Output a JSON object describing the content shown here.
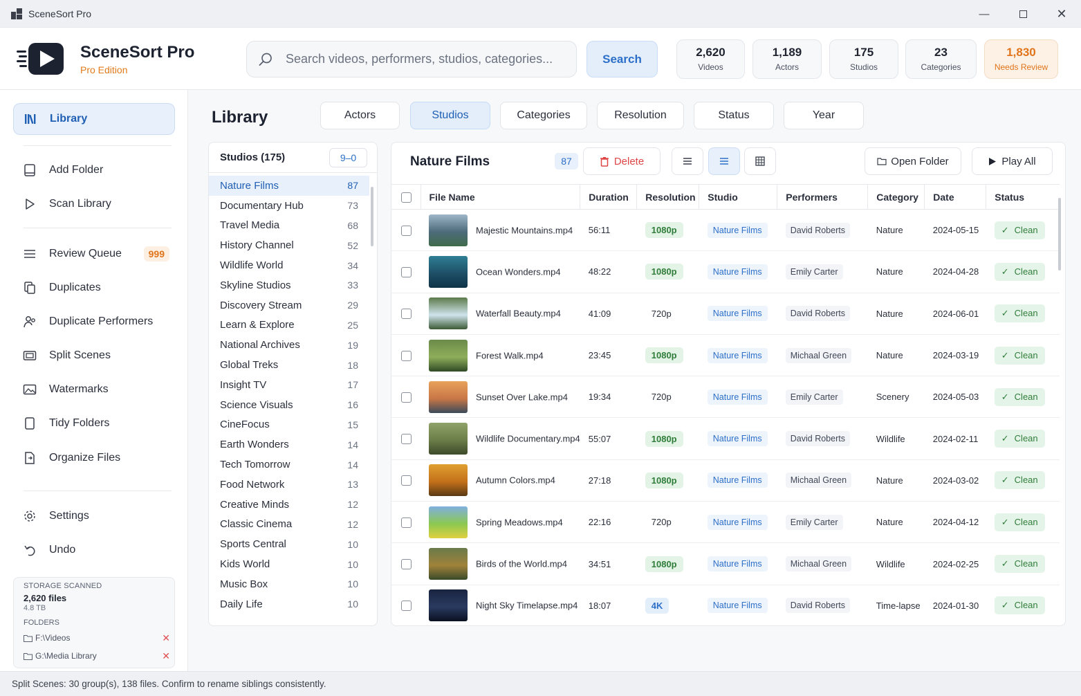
{
  "window": {
    "title": "SceneSort Pro"
  },
  "brand": {
    "name": "SceneSort Pro",
    "edition": "Pro Edition"
  },
  "search": {
    "placeholder": "Search videos, performers, studios, categories...",
    "button": "Search"
  },
  "stats": [
    {
      "value": "2,620",
      "label": "Videos"
    },
    {
      "value": "1,189",
      "label": "Actors"
    },
    {
      "value": "175",
      "label": "Studios"
    },
    {
      "value": "23",
      "label": "Categories"
    },
    {
      "value": "1,830",
      "label": "Needs Review"
    }
  ],
  "sidebar": {
    "items": [
      {
        "label": "Library",
        "icon": "library-icon"
      },
      {
        "label": "Add Folder",
        "icon": "add-folder-icon"
      },
      {
        "label": "Scan Library",
        "icon": "play-icon"
      },
      {
        "label": "Review Queue",
        "icon": "list-icon",
        "badge": "999"
      },
      {
        "label": "Duplicates",
        "icon": "duplicate-icon"
      },
      {
        "label": "Duplicate Performers",
        "icon": "people-icon"
      },
      {
        "label": "Split Scenes",
        "icon": "film-icon"
      },
      {
        "label": "Watermarks",
        "icon": "image-icon"
      },
      {
        "label": "Tidy Folders",
        "icon": "folder-icon"
      },
      {
        "label": "Organize Files",
        "icon": "organize-icon"
      },
      {
        "label": "Settings",
        "icon": "gear-icon"
      },
      {
        "label": "Undo",
        "icon": "undo-icon"
      }
    ],
    "storage": {
      "caption": "STORAGE SCANNED",
      "files": "2,620 files",
      "size": "4.8 TB",
      "folders_caption": "FOLDERS",
      "folders": [
        "F:\\Videos",
        "G:\\Media Library"
      ]
    }
  },
  "main": {
    "title": "Library",
    "tabs": [
      "Actors",
      "Studios",
      "Categories",
      "Resolution",
      "Status",
      "Year"
    ],
    "active_tab": "Studios"
  },
  "studios": {
    "header": "Studios (175)",
    "sort": "9–0",
    "items": [
      {
        "name": "Nature Films",
        "count": "87"
      },
      {
        "name": "Documentary Hub",
        "count": "73"
      },
      {
        "name": "Travel Media",
        "count": "68"
      },
      {
        "name": "History Channel",
        "count": "52"
      },
      {
        "name": "Wildlife World",
        "count": "34"
      },
      {
        "name": "Skyline Studios",
        "count": "33"
      },
      {
        "name": "Discovery Stream",
        "count": "29"
      },
      {
        "name": "Learn & Explore",
        "count": "25"
      },
      {
        "name": "National Archives",
        "count": "19"
      },
      {
        "name": "Global Treks",
        "count": "18"
      },
      {
        "name": "Insight TV",
        "count": "17"
      },
      {
        "name": "Science Visuals",
        "count": "16"
      },
      {
        "name": "CineFocus",
        "count": "15"
      },
      {
        "name": "Earth Wonders",
        "count": "14"
      },
      {
        "name": "Tech Tomorrow",
        "count": "14"
      },
      {
        "name": "Food Network",
        "count": "13"
      },
      {
        "name": "Creative Minds",
        "count": "12"
      },
      {
        "name": "Classic Cinema",
        "count": "12"
      },
      {
        "name": "Sports Central",
        "count": "10"
      },
      {
        "name": "Kids World",
        "count": "10"
      },
      {
        "name": "Music Box",
        "count": "10"
      },
      {
        "name": "Daily Life",
        "count": "10"
      }
    ]
  },
  "files": {
    "title": "Nature Films",
    "count": "87",
    "delete_label": "Delete",
    "open_folder_label": "Open Folder",
    "play_all_label": "Play All",
    "columns": [
      "File Name",
      "Duration",
      "Resolution",
      "Studio",
      "Performers",
      "Category",
      "Date",
      "Status"
    ],
    "rows": [
      {
        "file": "Majestic Mountains.mp4",
        "duration": "56:11",
        "resolution": "1080p",
        "studio": "Nature Films",
        "performer": "David Roberts",
        "category": "Nature",
        "date": "2024-05-15",
        "status": "Clean"
      },
      {
        "file": "Ocean Wonders.mp4",
        "duration": "48:22",
        "resolution": "1080p",
        "studio": "Nature Films",
        "performer": "Emily Carter",
        "category": "Nature",
        "date": "2024-04-28",
        "status": "Clean"
      },
      {
        "file": "Waterfall Beauty.mp4",
        "duration": "41:09",
        "resolution": "720p",
        "studio": "Nature Films",
        "performer": "David Roberts",
        "category": "Nature",
        "date": "2024-06-01",
        "status": "Clean"
      },
      {
        "file": "Forest Walk.mp4",
        "duration": "23:45",
        "resolution": "1080p",
        "studio": "Nature Films",
        "performer": "Michaal Green",
        "category": "Nature",
        "date": "2024-03-19",
        "status": "Clean"
      },
      {
        "file": "Sunset Over Lake.mp4",
        "duration": "19:34",
        "resolution": "720p",
        "studio": "Nature Films",
        "performer": "Emily Carter",
        "category": "Scenery",
        "date": "2024-05-03",
        "status": "Clean"
      },
      {
        "file": "Wildlife Documentary.mp4",
        "duration": "55:07",
        "resolution": "1080p",
        "studio": "Nature Films",
        "performer": "David Roberts",
        "category": "Wildlife",
        "date": "2024-02-11",
        "status": "Clean"
      },
      {
        "file": "Autumn Colors.mp4",
        "duration": "27:18",
        "resolution": "1080p",
        "studio": "Nature Films",
        "performer": "Michaal Green",
        "category": "Nature",
        "date": "2024-03-02",
        "status": "Clean"
      },
      {
        "file": "Spring Meadows.mp4",
        "duration": "22:16",
        "resolution": "720p",
        "studio": "Nature Films",
        "performer": "Emily Carter",
        "category": "Nature",
        "date": "2024-04-12",
        "status": "Clean"
      },
      {
        "file": "Birds of the World.mp4",
        "duration": "34:51",
        "resolution": "1080p",
        "studio": "Nature Films",
        "performer": "Michaal Green",
        "category": "Wildlife",
        "date": "2024-02-25",
        "status": "Clean"
      },
      {
        "file": "Night Sky Timelapse.mp4",
        "duration": "18:07",
        "resolution": "4K",
        "studio": "Nature Films",
        "performer": "David Roberts",
        "category": "Time-lapse",
        "date": "2024-01-30",
        "status": "Clean"
      }
    ]
  },
  "statusbar": {
    "text": "Split Scenes: 30 group(s), 138 files. Confirm to rename siblings consistently."
  },
  "colors": {
    "accent": "#2c6fc9",
    "warning": "#e0741a",
    "success": "#2f7d3a",
    "danger": "#e04545"
  }
}
